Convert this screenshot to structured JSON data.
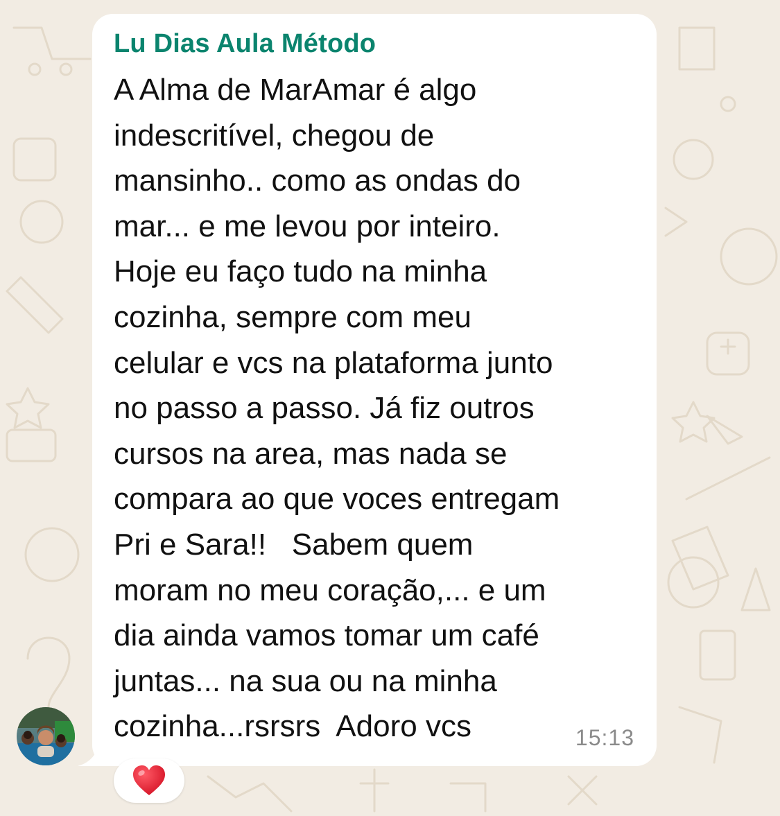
{
  "chat": {
    "sender_name": "Lu Dias Aula Método",
    "message_lines": [
      "A Alma de MarAmar é algo",
      "indescritível, chegou de",
      "mansinho.. como as ondas do",
      "mar... e me levou por inteiro.",
      "Hoje eu faço tudo na minha",
      "cozinha, sempre com meu",
      "celular e vcs na plataforma junto",
      "no passo a passo. Já fiz outros",
      "cursos na area, mas nada se",
      "compara ao que voces entregam",
      "Pri e Sara!!   Sabem quem",
      "moram no meu coração,... e um",
      "dia ainda vamos tomar um café",
      "juntas... na sua ou na minha",
      "cozinha...rsrsrs  Adoro vcs"
    ],
    "timestamp": "15:13",
    "reaction_icon": "red-heart-icon",
    "avatar_icon": "sender-avatar"
  },
  "colors": {
    "wallpaper": "#f2ece3",
    "bubble": "#ffffff",
    "sender_name": "#0b846e",
    "text": "#111111",
    "timestamp": "#8a8a8a",
    "heart": "#e0162b"
  }
}
